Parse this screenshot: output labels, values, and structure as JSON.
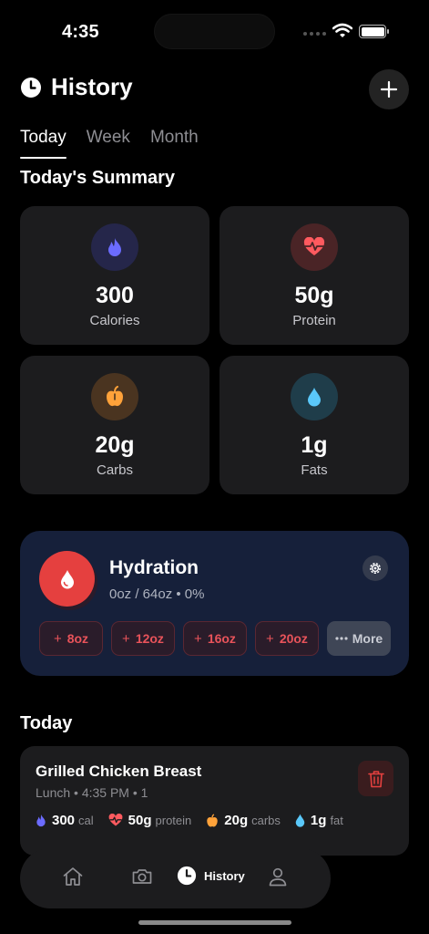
{
  "status_bar": {
    "time": "4:35"
  },
  "header": {
    "title": "History",
    "icon": "clock-icon",
    "add_icon": "plus-icon"
  },
  "tabs": [
    {
      "label": "Today",
      "active": true
    },
    {
      "label": "Week",
      "active": false
    },
    {
      "label": "Month",
      "active": false
    }
  ],
  "summary": {
    "title": "Today's Summary",
    "cards": [
      {
        "value": "300",
        "label": "Calories",
        "icon": "flame-icon",
        "color": "#6b6bff",
        "bg": "#25264a"
      },
      {
        "value": "50g",
        "label": "Protein",
        "icon": "heart-pulse-icon",
        "color": "#ff5a5f",
        "bg": "#4a2426"
      },
      {
        "value": "20g",
        "label": "Carbs",
        "icon": "apple-icon",
        "color": "#ffa23a",
        "bg": "#4a3420"
      },
      {
        "value": "1g",
        "label": "Fats",
        "icon": "drop-icon",
        "color": "#5ac8fa",
        "bg": "#1f3d4a"
      }
    ]
  },
  "hydration": {
    "title": "Hydration",
    "subtitle": "0oz / 64oz • 0%",
    "progress_percent": 0,
    "quick_add": [
      "8oz",
      "12oz",
      "16oz",
      "20oz"
    ],
    "more_label": "More"
  },
  "today_section": {
    "title": "Today"
  },
  "meals": [
    {
      "name": "Grilled Chicken Breast",
      "meta": "Lunch • 4:35 PM • 1",
      "macros": [
        {
          "value": "300",
          "unit": "cal",
          "icon": "flame-icon"
        },
        {
          "value": "50g",
          "unit": "protein",
          "icon": "heart-pulse-icon"
        },
        {
          "value": "20g",
          "unit": "carbs",
          "icon": "apple-icon"
        },
        {
          "value": "1g",
          "unit": "fat",
          "icon": "drop-icon"
        }
      ]
    }
  ],
  "tab_bar": {
    "items": [
      {
        "icon": "home-icon",
        "label": ""
      },
      {
        "icon": "camera-icon",
        "label": ""
      },
      {
        "icon": "clock-icon",
        "label": "History",
        "active": true
      },
      {
        "icon": "person-icon",
        "label": ""
      }
    ]
  }
}
